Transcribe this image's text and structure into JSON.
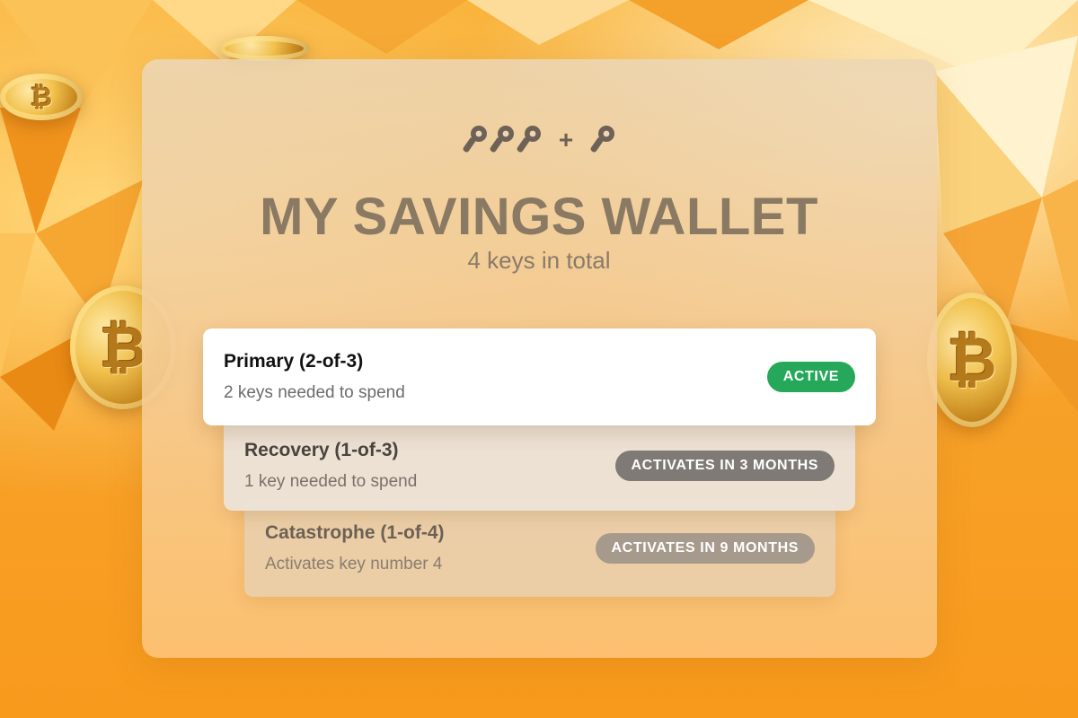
{
  "header": {
    "key_icons_left": [
      "key-icon",
      "key-icon",
      "key-icon"
    ],
    "plus": "+",
    "key_icons_right": [
      "key-icon"
    ],
    "title": "MY SAVINGS WALLET",
    "subtitle": "4 keys in total"
  },
  "spending_paths": [
    {
      "name": "Primary (2-of-3)",
      "description": "2 keys needed to spend",
      "status": "ACTIVE",
      "status_color": "#25a85a"
    },
    {
      "name": "Recovery (1-of-3)",
      "description": "1 key needed to spend",
      "status": "ACTIVATES IN 3 MONTHS",
      "status_color": "#7f7a75"
    },
    {
      "name": "Catastrophe (1-of-4)",
      "description": "Activates key number 4",
      "status": "ACTIVATES IN 9 MONTHS",
      "status_color": "#a69a8c"
    }
  ],
  "colors": {
    "background_accent": "#f7a022",
    "title": "#8a7963",
    "active": "#25a85a"
  }
}
